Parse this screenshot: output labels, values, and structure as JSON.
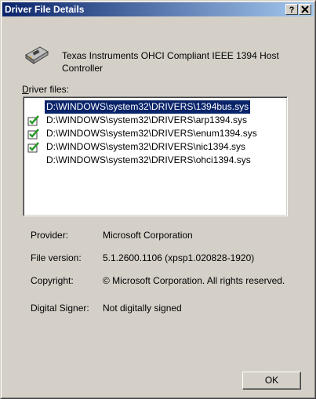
{
  "window": {
    "title": "Driver File Details",
    "help_button": "?",
    "close_button": "x"
  },
  "device": {
    "name": "Texas Instruments OHCI Compliant IEEE 1394 Host Controller",
    "icon": "pci-card-icon"
  },
  "files": {
    "label_prefix": "D",
    "label_rest": "river files:",
    "items": [
      {
        "path": "D:\\WINDOWS\\system32\\DRIVERS\\1394bus.sys",
        "signed": false,
        "selected": true
      },
      {
        "path": "D:\\WINDOWS\\system32\\DRIVERS\\arp1394.sys",
        "signed": true,
        "selected": false
      },
      {
        "path": "D:\\WINDOWS\\system32\\DRIVERS\\enum1394.sys",
        "signed": true,
        "selected": false
      },
      {
        "path": "D:\\WINDOWS\\system32\\DRIVERS\\nic1394.sys",
        "signed": true,
        "selected": false
      },
      {
        "path": "D:\\WINDOWS\\system32\\DRIVERS\\ohci1394.sys",
        "signed": false,
        "selected": false
      }
    ]
  },
  "properties": {
    "provider_label": "Provider:",
    "provider_value": "Microsoft Corporation",
    "version_label": "File version:",
    "version_value": "5.1.2600.1106 (xpsp1.020828-1920)",
    "copyright_label": "Copyright:",
    "copyright_value": "© Microsoft Corporation. All rights reserved.",
    "signer_label": "Digital Signer:",
    "signer_value": "Not digitally signed"
  },
  "buttons": {
    "ok": "OK"
  },
  "colors": {
    "title_bar": "#0a246a",
    "selection": "#0a246a",
    "dialog_face": "#d4d0c8",
    "signed_check": "#2a9a2a"
  }
}
